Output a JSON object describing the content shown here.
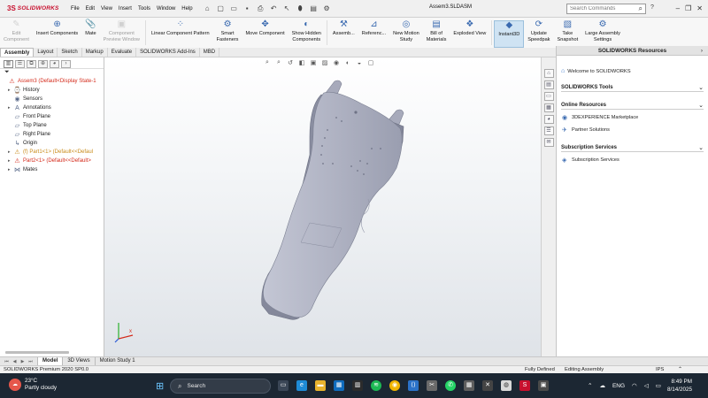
{
  "app": {
    "logo_ds": "3S",
    "logo_text": "SOLIDWORKS",
    "menus": [
      "File",
      "Edit",
      "View",
      "Insert",
      "Tools",
      "Window",
      "Help"
    ],
    "document_title": "Assem3.SLDASM",
    "search_placeholder": "Search Commands"
  },
  "commands": [
    {
      "label": "Edit\nComponent",
      "icon": "edit-component-icon",
      "glyph": "✎",
      "disabled": true
    },
    {
      "label": "Insert Components",
      "icon": "insert-components-icon",
      "glyph": "⊕",
      "disabled": false
    },
    {
      "label": "Mate",
      "icon": "mate-icon",
      "glyph": "📎",
      "disabled": false
    },
    {
      "label": "Component\nPreview Window",
      "icon": "preview-window-icon",
      "glyph": "▣",
      "disabled": true
    },
    {
      "label": "Linear Component Pattern",
      "icon": "linear-pattern-icon",
      "glyph": "⁘",
      "disabled": false
    },
    {
      "label": "Smart\nFasteners",
      "icon": "smart-fasteners-icon",
      "glyph": "⚙",
      "disabled": false
    },
    {
      "label": "Move Component",
      "icon": "move-component-icon",
      "glyph": "✥",
      "disabled": false
    },
    {
      "label": "Show Hidden\nComponents",
      "icon": "show-hidden-icon",
      "glyph": "◐",
      "disabled": false
    },
    {
      "label": "Assemb...",
      "icon": "assembly-features-icon",
      "glyph": "⚒",
      "disabled": false
    },
    {
      "label": "Referenc...",
      "icon": "reference-geometry-icon",
      "glyph": "⊿",
      "disabled": false
    },
    {
      "label": "New Motion\nStudy",
      "icon": "motion-study-icon",
      "glyph": "◎",
      "disabled": false
    },
    {
      "label": "Bill of\nMaterials",
      "icon": "bom-icon",
      "glyph": "▤",
      "disabled": false
    },
    {
      "label": "Exploded View",
      "icon": "exploded-view-icon",
      "glyph": "❖",
      "disabled": false
    },
    {
      "label": "Instant3D",
      "icon": "instant3d-icon",
      "glyph": "◆",
      "disabled": false,
      "active": true
    },
    {
      "label": "Update\nSpeedpak",
      "icon": "speedpak-icon",
      "glyph": "⟳",
      "disabled": false
    },
    {
      "label": "Take\nSnapshot",
      "icon": "snapshot-icon",
      "glyph": "▧",
      "disabled": false
    },
    {
      "label": "Large Assembly\nSettings",
      "icon": "large-assembly-icon",
      "glyph": "⚙",
      "disabled": false
    }
  ],
  "tabs": [
    "Assembly",
    "Layout",
    "Sketch",
    "Markup",
    "Evaluate",
    "SOLIDWORKS Add-Ins",
    "MBD"
  ],
  "tree": [
    {
      "label": "Assem3  (Default<Display State-1",
      "icon": "assembly-icon",
      "glyph": "⚠",
      "color": "red",
      "toggle": "",
      "level": 0
    },
    {
      "label": "History",
      "icon": "history-icon",
      "glyph": "⌚",
      "toggle": "▸",
      "level": 1
    },
    {
      "label": "Sensors",
      "icon": "sensors-icon",
      "glyph": "◉",
      "toggle": "",
      "level": 1
    },
    {
      "label": "Annotations",
      "icon": "annotations-icon",
      "glyph": "A",
      "toggle": "▸",
      "level": 1
    },
    {
      "label": "Front Plane",
      "icon": "plane-icon",
      "glyph": "▱",
      "toggle": "",
      "level": 1
    },
    {
      "label": "Top Plane",
      "icon": "plane-icon",
      "glyph": "▱",
      "toggle": "",
      "level": 1
    },
    {
      "label": "Right Plane",
      "icon": "plane-icon",
      "glyph": "▱",
      "toggle": "",
      "level": 1
    },
    {
      "label": "Origin",
      "icon": "origin-icon",
      "glyph": "↳",
      "toggle": "",
      "level": 1
    },
    {
      "label": "(f) Part1<1> (Default<<Defaul",
      "icon": "part-warning-icon",
      "glyph": "⚠",
      "color": "orange",
      "toggle": "▸",
      "level": 1
    },
    {
      "label": "Part2<1> (Default<<Default>",
      "icon": "part-error-icon",
      "glyph": "⚠",
      "color": "red",
      "toggle": "▸",
      "level": 1
    },
    {
      "label": "Mates",
      "icon": "mates-icon",
      "glyph": "⋈",
      "toggle": "▸",
      "level": 1
    }
  ],
  "bottom_tabs": [
    "Model",
    "3D Views",
    "Motion Study 1"
  ],
  "status": {
    "version": "SOLIDWORKS Premium 2020 SP0.0",
    "defined": "Fully Defined",
    "mode": "Editing Assembly",
    "units": "IPS",
    "expand": "⌃"
  },
  "task_pane": {
    "title": "SOLIDWORKS Resources",
    "welcome": "Welcome to SOLIDWORKS",
    "sections": [
      {
        "title": "SOLIDWORKS Tools",
        "links": []
      },
      {
        "title": "Online Resources",
        "links": [
          {
            "label": "3DEXPERIENCE Marketplace",
            "icon": "marketplace-icon",
            "glyph": "◉"
          },
          {
            "label": "Partner Solutions",
            "icon": "partner-icon",
            "glyph": "✈"
          }
        ]
      },
      {
        "title": "Subscription Services",
        "links": [
          {
            "label": "Subscription Services",
            "icon": "subscription-icon",
            "glyph": "◈"
          }
        ]
      }
    ]
  },
  "taskbar": {
    "temperature": "23°C",
    "weather": "Partly cloudy",
    "search": "Search",
    "lang": "ENG",
    "time": "8:49 PM",
    "date": "8/14/2025"
  }
}
